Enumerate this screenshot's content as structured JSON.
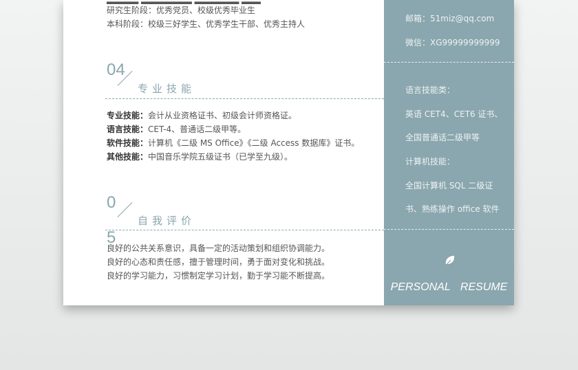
{
  "honors": {
    "line1": "研究生阶段：优秀党员、校级优秀毕业生",
    "line2": "本科阶段：校级三好学生、优秀学生干部、优秀主持人"
  },
  "skills_section": {
    "number": "04",
    "title": "专业技能"
  },
  "skills": [
    {
      "label": "专业技能：",
      "text": "会计从业资格证书、初级会计师资格证。"
    },
    {
      "label": "语言技能：",
      "text": "CET-4、普通话二级甲等。"
    },
    {
      "label": "软件技能：",
      "text": "计算机《二级 MS Office》《二级 Access 数据库》证书。"
    },
    {
      "label": "其他技能：",
      "text": "中国音乐学院五级证书（已学至九级）。"
    }
  ],
  "self_section": {
    "number_top": "0",
    "number_bottom": "5",
    "title": "自我评价"
  },
  "self_eval": {
    "line1": "良好的公共关系意识，具备一定的活动策划和组织协调能力。",
    "line2": "良好的心态和责任感，擅于管理时间，勇于面对变化和挑战。",
    "line3": "良好的学习能力，习惯制定学习计划，勤于学习能不断提高。"
  },
  "sidebar": {
    "email": "邮箱：51miz@qq.com",
    "wechat": "微信：XG99999999999",
    "lang_header": "语言技能类：",
    "lang_line1": "英语 CET4、CET6 证书、",
    "lang_line2": "全国普通话二级甲等",
    "comp_header": "计算机技能：",
    "comp_line1": "全国计算机 SQL 二级证",
    "comp_line2": "书、熟练操作 office 软件",
    "footer": "PERSONAL RESUME"
  },
  "colors": {
    "accent": "#8aa6ae",
    "text": "#555555"
  },
  "icons": {
    "leaf": "leaf-icon"
  }
}
